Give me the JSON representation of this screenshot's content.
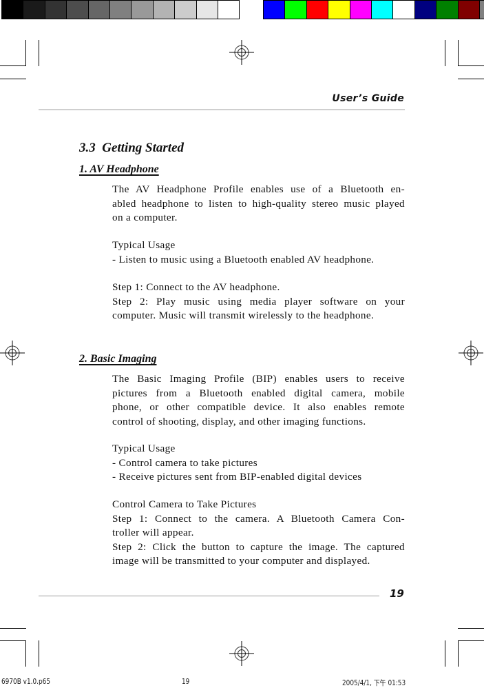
{
  "color_bars": {
    "grays": [
      "#000000",
      "#1a1a1a",
      "#333333",
      "#4d4d4d",
      "#666666",
      "#808080",
      "#999999",
      "#b3b3b3",
      "#cccccc",
      "#e6e6e6",
      "#ffffff"
    ],
    "colors": [
      "#0000ff",
      "#00ff00",
      "#ff0000",
      "#ffff00",
      "#ff00ff",
      "#00ffff",
      "#ffffff",
      "#000080",
      "#008000",
      "#800000",
      "#808080"
    ]
  },
  "header": {
    "title": "User’s Guide"
  },
  "section": {
    "title": "3.3  Getting Started"
  },
  "av_headphone": {
    "heading": "1. AV Headphone",
    "intro_lines": [
      "The AV Headphone Profile enables use of a Bluetooth en-",
      "abled headphone to listen to high-quality stereo music played",
      "on a computer."
    ],
    "usage_label": "Typical Usage",
    "usage_items": [
      "- Listen to music using a Bluetooth enabled AV headphone."
    ],
    "steps_lines": [
      "Step 1: Connect to the AV headphone.",
      "Step 2: Play music using media player software on your",
      "computer. Music will transmit wirelessly to the headphone."
    ]
  },
  "basic_imaging": {
    "heading": "2. Basic Imaging",
    "intro_lines": [
      "The Basic Imaging Profile (BIP) enables users to receive",
      "pictures from a Bluetooth enabled digital camera, mobile",
      "phone, or other compatible device. It also enables remote",
      "control of shooting, display, and other imaging functions."
    ],
    "usage_label": "Typical Usage",
    "usage_items": [
      "- Control camera to take pictures",
      "- Receive pictures sent from BIP-enabled digital devices"
    ],
    "control_label": "Control Camera to Take Pictures",
    "steps_lines": [
      "Step 1: Connect to the camera. A Bluetooth Camera Con-",
      "troller will appear.",
      "Step 2: Click the button to capture the image. The captured",
      "image will be transmitted to your computer and displayed."
    ]
  },
  "footer": {
    "page_number": "19"
  },
  "slug": {
    "file": "6970B v1.0.p65",
    "page": "19",
    "datetime": "2005/4/1, 下午 01:53"
  }
}
